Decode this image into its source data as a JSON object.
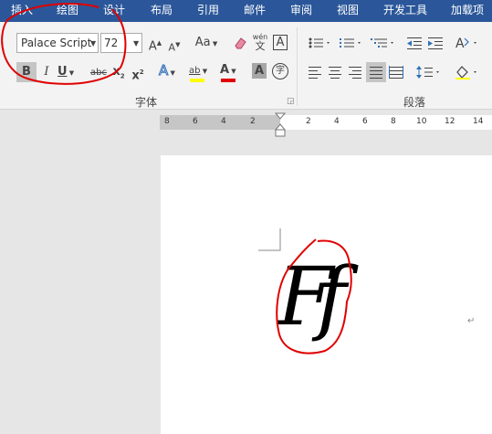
{
  "menu": {
    "items": [
      "插入",
      "绘图",
      "设计",
      "布局",
      "引用",
      "邮件",
      "审阅",
      "视图",
      "开发工具",
      "加载项"
    ]
  },
  "font_group": {
    "font_name": "Palace Script",
    "font_size": "72",
    "grow_font_label": "A",
    "shrink_font_label": "A",
    "change_case_label": "Aa",
    "phonetic_top": "wén",
    "phonetic_bottom": "文",
    "char_border_label": "A",
    "bold_label": "B",
    "italic_label": "I",
    "underline_label": "U",
    "strike_label": "abc",
    "subscript_base": "x",
    "subscript_mark": "2",
    "superscript_base": "x",
    "superscript_mark": "2",
    "effects_label": "A",
    "highlight_label": "ab",
    "font_color_label": "A",
    "char_shading_label": "A",
    "enclosed_char_label": "字",
    "group_label": "字体"
  },
  "paragraph_group": {
    "group_label": "段落"
  },
  "ruler": {
    "ticks": [
      "8",
      "6",
      "4",
      "2",
      "2",
      "4",
      "6",
      "8",
      "10",
      "12",
      "14"
    ]
  },
  "document": {
    "content": "Ff"
  },
  "colors": {
    "menu_bar": "#2b579a",
    "highlight": "#ffff00",
    "font_color": "#e00000",
    "annotation": "#e00000"
  }
}
